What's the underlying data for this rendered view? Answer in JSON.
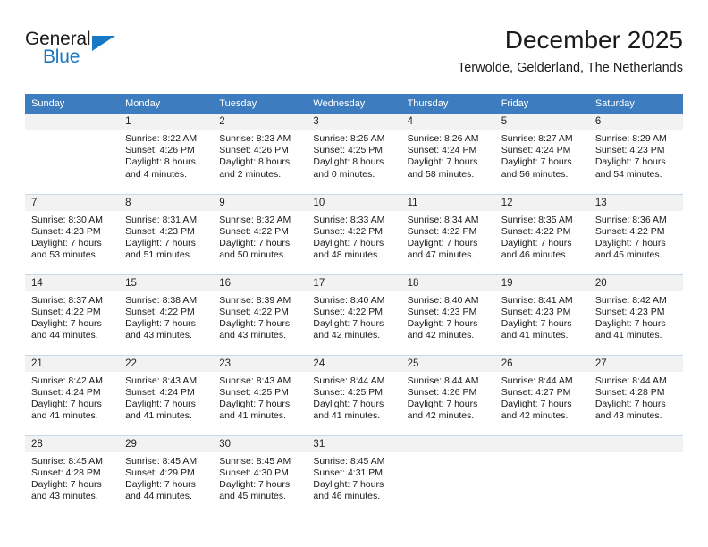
{
  "brand": {
    "name_top": "General",
    "name_bottom": "Blue",
    "accent_color": "#1878c4"
  },
  "header": {
    "title": "December 2025",
    "subtitle": "Terwolde, Gelderland, The Netherlands",
    "header_bar_color": "#3d7dbf",
    "daynum_band_color": "#f2f2f2"
  },
  "weekday_headers": [
    "Sunday",
    "Monday",
    "Tuesday",
    "Wednesday",
    "Thursday",
    "Friday",
    "Saturday"
  ],
  "weeks": [
    [
      {
        "day": "",
        "lines": []
      },
      {
        "day": "1",
        "lines": [
          "Sunrise: 8:22 AM",
          "Sunset: 4:26 PM",
          "Daylight: 8 hours",
          "and 4 minutes."
        ]
      },
      {
        "day": "2",
        "lines": [
          "Sunrise: 8:23 AM",
          "Sunset: 4:26 PM",
          "Daylight: 8 hours",
          "and 2 minutes."
        ]
      },
      {
        "day": "3",
        "lines": [
          "Sunrise: 8:25 AM",
          "Sunset: 4:25 PM",
          "Daylight: 8 hours",
          "and 0 minutes."
        ]
      },
      {
        "day": "4",
        "lines": [
          "Sunrise: 8:26 AM",
          "Sunset: 4:24 PM",
          "Daylight: 7 hours",
          "and 58 minutes."
        ]
      },
      {
        "day": "5",
        "lines": [
          "Sunrise: 8:27 AM",
          "Sunset: 4:24 PM",
          "Daylight: 7 hours",
          "and 56 minutes."
        ]
      },
      {
        "day": "6",
        "lines": [
          "Sunrise: 8:29 AM",
          "Sunset: 4:23 PM",
          "Daylight: 7 hours",
          "and 54 minutes."
        ]
      }
    ],
    [
      {
        "day": "7",
        "lines": [
          "Sunrise: 8:30 AM",
          "Sunset: 4:23 PM",
          "Daylight: 7 hours",
          "and 53 minutes."
        ]
      },
      {
        "day": "8",
        "lines": [
          "Sunrise: 8:31 AM",
          "Sunset: 4:23 PM",
          "Daylight: 7 hours",
          "and 51 minutes."
        ]
      },
      {
        "day": "9",
        "lines": [
          "Sunrise: 8:32 AM",
          "Sunset: 4:22 PM",
          "Daylight: 7 hours",
          "and 50 minutes."
        ]
      },
      {
        "day": "10",
        "lines": [
          "Sunrise: 8:33 AM",
          "Sunset: 4:22 PM",
          "Daylight: 7 hours",
          "and 48 minutes."
        ]
      },
      {
        "day": "11",
        "lines": [
          "Sunrise: 8:34 AM",
          "Sunset: 4:22 PM",
          "Daylight: 7 hours",
          "and 47 minutes."
        ]
      },
      {
        "day": "12",
        "lines": [
          "Sunrise: 8:35 AM",
          "Sunset: 4:22 PM",
          "Daylight: 7 hours",
          "and 46 minutes."
        ]
      },
      {
        "day": "13",
        "lines": [
          "Sunrise: 8:36 AM",
          "Sunset: 4:22 PM",
          "Daylight: 7 hours",
          "and 45 minutes."
        ]
      }
    ],
    [
      {
        "day": "14",
        "lines": [
          "Sunrise: 8:37 AM",
          "Sunset: 4:22 PM",
          "Daylight: 7 hours",
          "and 44 minutes."
        ]
      },
      {
        "day": "15",
        "lines": [
          "Sunrise: 8:38 AM",
          "Sunset: 4:22 PM",
          "Daylight: 7 hours",
          "and 43 minutes."
        ]
      },
      {
        "day": "16",
        "lines": [
          "Sunrise: 8:39 AM",
          "Sunset: 4:22 PM",
          "Daylight: 7 hours",
          "and 43 minutes."
        ]
      },
      {
        "day": "17",
        "lines": [
          "Sunrise: 8:40 AM",
          "Sunset: 4:22 PM",
          "Daylight: 7 hours",
          "and 42 minutes."
        ]
      },
      {
        "day": "18",
        "lines": [
          "Sunrise: 8:40 AM",
          "Sunset: 4:23 PM",
          "Daylight: 7 hours",
          "and 42 minutes."
        ]
      },
      {
        "day": "19",
        "lines": [
          "Sunrise: 8:41 AM",
          "Sunset: 4:23 PM",
          "Daylight: 7 hours",
          "and 41 minutes."
        ]
      },
      {
        "day": "20",
        "lines": [
          "Sunrise: 8:42 AM",
          "Sunset: 4:23 PM",
          "Daylight: 7 hours",
          "and 41 minutes."
        ]
      }
    ],
    [
      {
        "day": "21",
        "lines": [
          "Sunrise: 8:42 AM",
          "Sunset: 4:24 PM",
          "Daylight: 7 hours",
          "and 41 minutes."
        ]
      },
      {
        "day": "22",
        "lines": [
          "Sunrise: 8:43 AM",
          "Sunset: 4:24 PM",
          "Daylight: 7 hours",
          "and 41 minutes."
        ]
      },
      {
        "day": "23",
        "lines": [
          "Sunrise: 8:43 AM",
          "Sunset: 4:25 PM",
          "Daylight: 7 hours",
          "and 41 minutes."
        ]
      },
      {
        "day": "24",
        "lines": [
          "Sunrise: 8:44 AM",
          "Sunset: 4:25 PM",
          "Daylight: 7 hours",
          "and 41 minutes."
        ]
      },
      {
        "day": "25",
        "lines": [
          "Sunrise: 8:44 AM",
          "Sunset: 4:26 PM",
          "Daylight: 7 hours",
          "and 42 minutes."
        ]
      },
      {
        "day": "26",
        "lines": [
          "Sunrise: 8:44 AM",
          "Sunset: 4:27 PM",
          "Daylight: 7 hours",
          "and 42 minutes."
        ]
      },
      {
        "day": "27",
        "lines": [
          "Sunrise: 8:44 AM",
          "Sunset: 4:28 PM",
          "Daylight: 7 hours",
          "and 43 minutes."
        ]
      }
    ],
    [
      {
        "day": "28",
        "lines": [
          "Sunrise: 8:45 AM",
          "Sunset: 4:28 PM",
          "Daylight: 7 hours",
          "and 43 minutes."
        ]
      },
      {
        "day": "29",
        "lines": [
          "Sunrise: 8:45 AM",
          "Sunset: 4:29 PM",
          "Daylight: 7 hours",
          "and 44 minutes."
        ]
      },
      {
        "day": "30",
        "lines": [
          "Sunrise: 8:45 AM",
          "Sunset: 4:30 PM",
          "Daylight: 7 hours",
          "and 45 minutes."
        ]
      },
      {
        "day": "31",
        "lines": [
          "Sunrise: 8:45 AM",
          "Sunset: 4:31 PM",
          "Daylight: 7 hours",
          "and 46 minutes."
        ]
      },
      {
        "day": "",
        "lines": []
      },
      {
        "day": "",
        "lines": []
      },
      {
        "day": "",
        "lines": []
      }
    ]
  ]
}
